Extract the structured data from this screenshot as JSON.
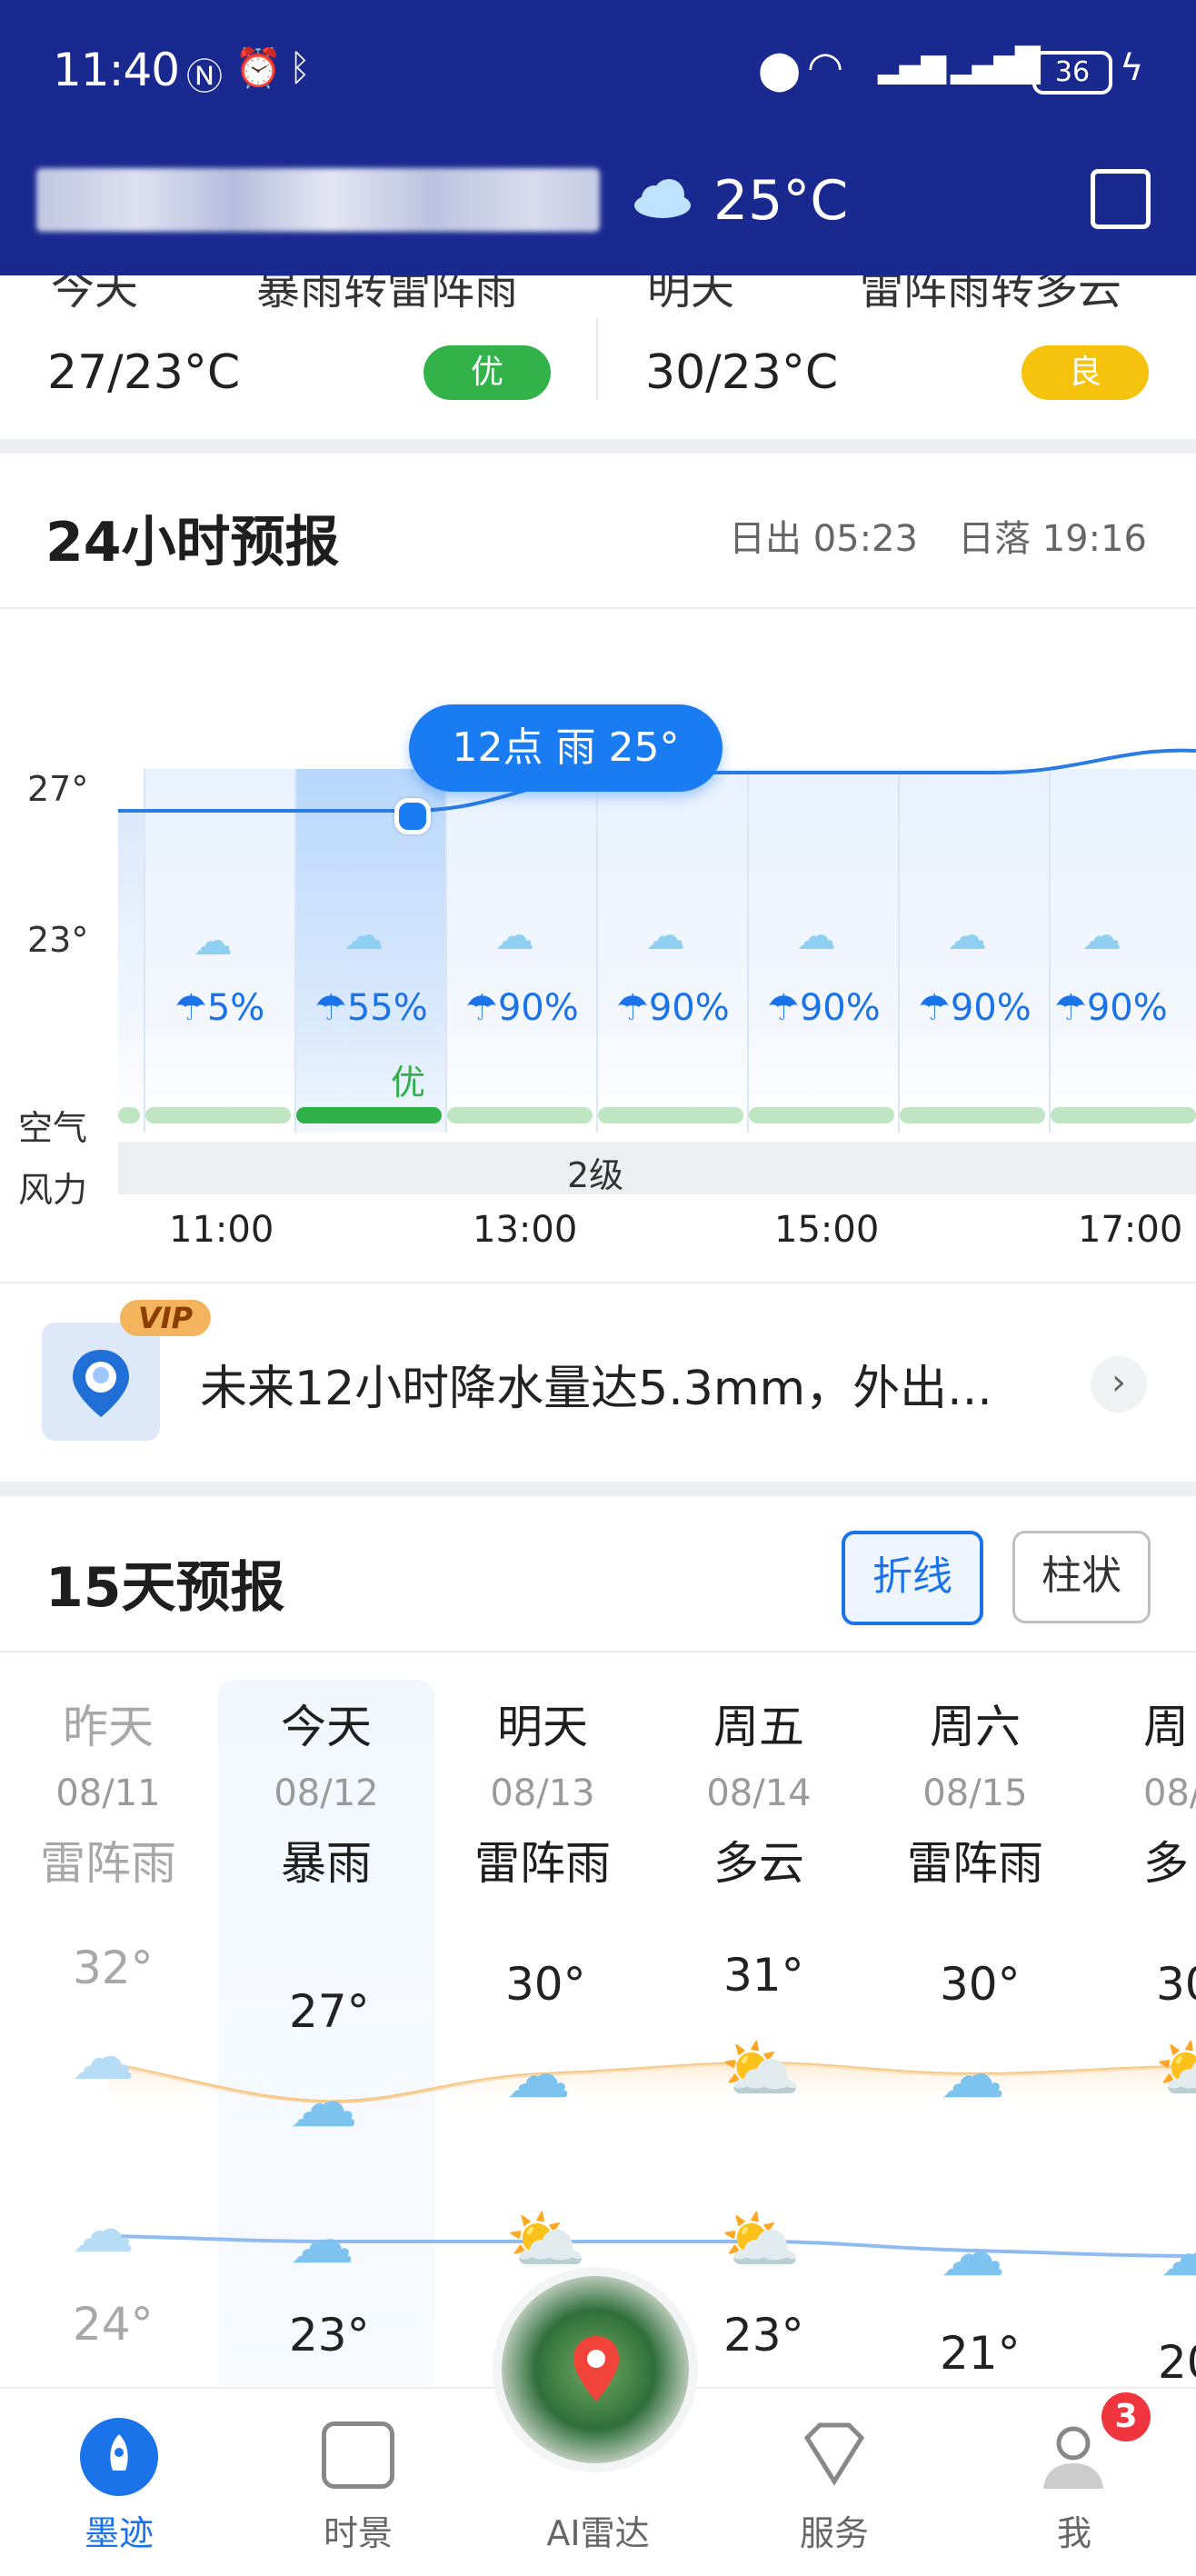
{
  "status_bar": {
    "time": "11:40",
    "battery": "36"
  },
  "header": {
    "temperature": "25°C"
  },
  "today_strip": {
    "today": {
      "label": "今天",
      "condition": "暴雨转雷阵雨",
      "range": "27/23°C",
      "aqi": "优",
      "aqi_color": "#34b24a"
    },
    "tomorrow": {
      "label": "明天",
      "condition": "雷阵雨转多云",
      "range": "30/23°C",
      "aqi": "良",
      "aqi_color": "#f5c20e"
    }
  },
  "forecast24": {
    "title": "24小时预报",
    "sunrise": "日出 05:23",
    "sunset": "日落 19:16",
    "y_labels": [
      "27°",
      "23°"
    ],
    "tooltip": "12点 雨 25°",
    "precip": [
      "5%",
      "55%",
      "90%",
      "90%",
      "90%",
      "90%",
      "90%"
    ],
    "aqi_selected": "优",
    "row_air": "空气",
    "row_wind": "风力",
    "wind_level": "2级",
    "times": [
      "11:00",
      "13:00",
      "15:00",
      "17:00"
    ]
  },
  "vip_alert": {
    "badge": "VIP",
    "text": "未来12小时降水量达5.3mm，外出..."
  },
  "forecast15": {
    "title": "15天预报",
    "btn_line": "折线",
    "btn_bar": "柱状",
    "days": [
      {
        "name": "昨天",
        "date": "08/11",
        "cond": "雷阵雨",
        "high": "32°",
        "low": "24°"
      },
      {
        "name": "今天",
        "date": "08/12",
        "cond": "暴雨",
        "high": "27°",
        "low": "23°"
      },
      {
        "name": "明天",
        "date": "08/13",
        "cond": "雷阵雨",
        "high": "30°",
        "low": ""
      },
      {
        "name": "周五",
        "date": "08/14",
        "cond": "多云",
        "high": "31°",
        "low": "23°"
      },
      {
        "name": "周六",
        "date": "08/15",
        "cond": "雷阵雨",
        "high": "30°",
        "low": "21°"
      },
      {
        "name": "周",
        "date": "08/",
        "cond": "多",
        "high": "30",
        "low": "20"
      }
    ]
  },
  "bottom_nav": {
    "items": [
      "墨迹",
      "时景",
      "AI雷达",
      "服务",
      "我"
    ],
    "badge": "3"
  }
}
